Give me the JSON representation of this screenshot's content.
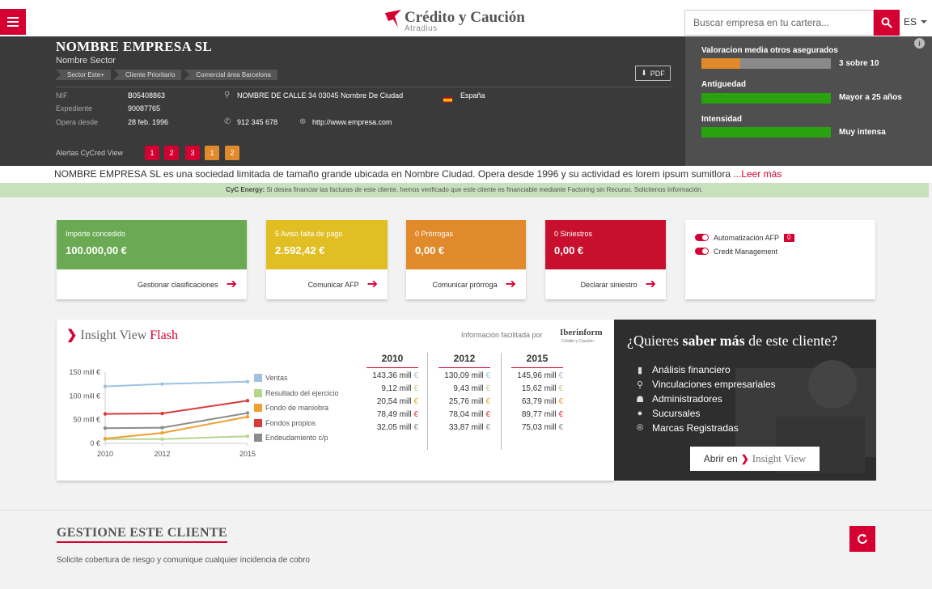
{
  "header": {
    "brand": "Crédito y Caución",
    "brand_sub": "Atradius",
    "search_placeholder": "Buscar empresa en tu cartera...",
    "language": "ES"
  },
  "company": {
    "name": "NOMBRE EMPRESA SL",
    "sector": "Nombre Sector",
    "tags": [
      "Sector Este+",
      "Cliente Prioritario",
      "Comercial área Barcelona"
    ],
    "pdf_label": "PDF",
    "nif_label": "NIF",
    "nif": "B05408863",
    "expediente_label": "Expediente",
    "expediente": "90087765",
    "opera_label": "Opera desde",
    "opera": "28 feb. 1996",
    "address": "NOMBRE DE CALLE 34 03045 Nombre De Ciudad",
    "country": "España",
    "phone": "912 345 678",
    "web": "http://www.empresa.com",
    "alerts_label": "Alertas CyCred View",
    "alerts": [
      {
        "value": "1",
        "color": "#d50032"
      },
      {
        "value": "2",
        "color": "#d50032"
      },
      {
        "value": "3",
        "color": "#d50032"
      },
      {
        "value": "1",
        "color": "#e08a2c"
      },
      {
        "value": "2",
        "color": "#e08a2c"
      }
    ]
  },
  "ratings": [
    {
      "label": "Valoracion media otros asegurados",
      "value": "3 sobre 10",
      "level": 0.3,
      "color": "#e08a2c"
    },
    {
      "label": "Antiguedad",
      "value": "Mayor a 25 años",
      "level": 1.0,
      "color": "#2aa10f"
    },
    {
      "label": "Intensidad",
      "value": "Muy intensa",
      "level": 1.0,
      "color": "#2aa10f"
    }
  ],
  "description": {
    "text": "NOMBRE EMPRESA SL es una sociedad limitada de tamaño grande ubicada en Nombre Ciudad. Opera desde 1996 y su actividad es lorem ipsum sumitlora ",
    "more": "...Leer más"
  },
  "energy": {
    "bold": "CyC Energy:",
    "text": " Si desea financiar las facturas de este cliente, hemos verificado que este cliente es financiable mediante Factoring sin Recurso. Solicitenos Información."
  },
  "cards": [
    {
      "title": "Importe concedido",
      "amount": "100.000,00 €",
      "action": "Gestionar clasificaciones",
      "color": "#6aaa52"
    },
    {
      "title": "5 Aviso falta de pago",
      "amount": "2.592,42 €",
      "action": "Comunicar AFP",
      "color": "#e1bf24"
    },
    {
      "title": "0 Prórrogas",
      "amount": "0,00 €",
      "action": "Comunicar prórroga",
      "color": "#e08a2c"
    },
    {
      "title": "0 Siniestros",
      "amount": "0,00 €",
      "action": "Declarar siniestro",
      "color": "#c8102e"
    }
  ],
  "automation": {
    "afp_label": "Automatización AFP",
    "afp_count": "0",
    "credit_label": "Credit Management"
  },
  "insight": {
    "title_a": "Insight View ",
    "title_b": "Flash",
    "source": "Información facilitada por",
    "provider": "Iberinform",
    "provider_sub": "Crédito y Caución"
  },
  "chart_data": {
    "type": "line",
    "x": [
      2010,
      2012,
      2015
    ],
    "y_ticks": [
      "150 mill €",
      "100 mill €",
      "50 mill €",
      "0 €"
    ],
    "ylim": [
      0,
      150
    ],
    "series": [
      {
        "name": "Ventas",
        "values": [
          120,
          125,
          130
        ],
        "color": "#9ec2e0"
      },
      {
        "name": "Resultado del ejercicio",
        "values": [
          9,
          9,
          15
        ],
        "color": "#b6d58e"
      },
      {
        "name": "Fondo de maniobra",
        "values": [
          10,
          22,
          56
        ],
        "color": "#f0a030"
      },
      {
        "name": "Fondos propios",
        "values": [
          62,
          63,
          90
        ],
        "color": "#d93a3a"
      },
      {
        "name": "Endeudamiento c/p",
        "values": [
          32,
          33,
          64
        ],
        "color": "#8c8c8c"
      }
    ]
  },
  "years": [
    {
      "year": "2010",
      "values": [
        "143,36 mill",
        "9,12 mill",
        "20,54 mill",
        "78,49 mill",
        "32,05 mill"
      ]
    },
    {
      "year": "2012",
      "values": [
        "130,09 mill",
        "9,43 mill",
        "25,76 mill",
        "78,04 mill",
        "33,87 mill"
      ]
    },
    {
      "year": "2015",
      "values": [
        "145,96 mill",
        "15,62 mill",
        "63,79 mill",
        "89,77 mill",
        "75,03 mill"
      ]
    }
  ],
  "euro_sign": "€",
  "promo": {
    "title_a": "¿Quieres ",
    "title_b": "saber más",
    "title_c": " de este cliente?",
    "items": [
      "Análisis financiero",
      "Vinculaciones empresariales",
      "Administradores",
      "Sucursales",
      "Marcas Registradas"
    ],
    "open_label": "Abrir en",
    "open_target": "Insight View"
  },
  "manage": {
    "title": "GESTIONE ESTE CLIENTE",
    "subtitle": "Solicite cobertura de riesgo y comunique cualquier incidencia de cobro"
  }
}
